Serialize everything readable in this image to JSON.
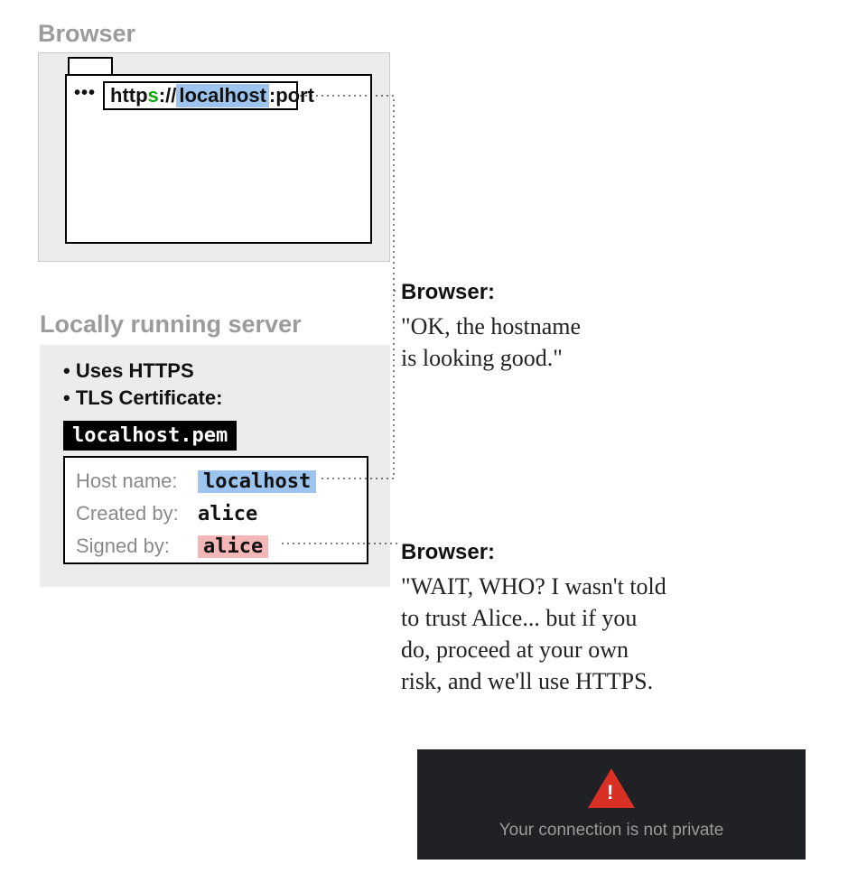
{
  "titles": {
    "browser": "Browser",
    "server": "Locally running server"
  },
  "browser_frame": {
    "dots": "•••",
    "url": {
      "prefix": "http",
      "s": "s",
      "sep": "://",
      "host": "localhost",
      "suffix": ":port"
    }
  },
  "server": {
    "bullet1": "• Uses HTTPS",
    "bullet2": "• TLS Certificate:",
    "file": "localhost.pem",
    "cert": {
      "host_key": "Host name:",
      "host_val": "localhost",
      "created_key": "Created by:",
      "created_val": "alice",
      "signed_key": "Signed by:",
      "signed_val": "alice"
    }
  },
  "callout1": {
    "speaker": "Browser:",
    "line1": "\"OK, the hostname",
    "line2": "is looking good.\""
  },
  "callout2": {
    "speaker": "Browser:",
    "line1": "\"WAIT, WHO? I wasn't told",
    "line2": "to trust Alice... but if you",
    "line3": "do, proceed at your own",
    "line4": "risk, and we'll use HTTPS."
  },
  "warning": {
    "text": "Your connection is not private"
  }
}
